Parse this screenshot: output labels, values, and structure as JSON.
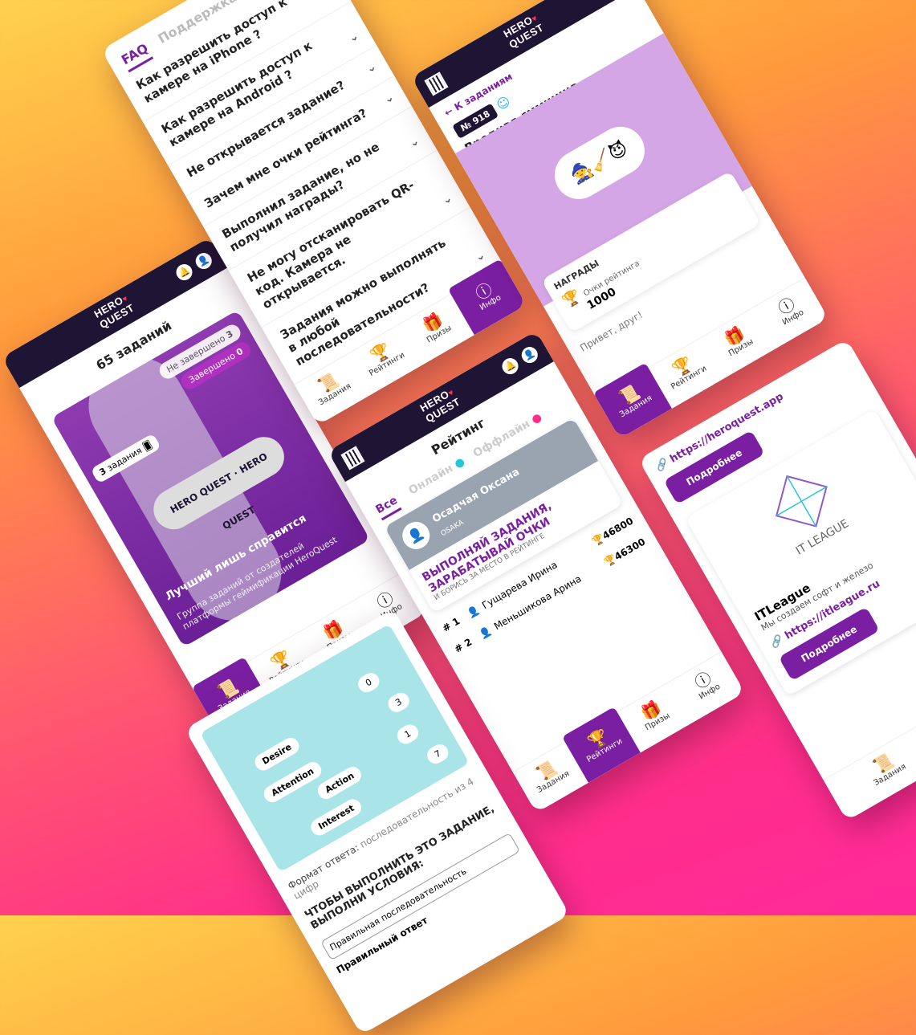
{
  "logo": {
    "line1": "HERO",
    "line2": "QUEST"
  },
  "nav": {
    "tasks": "Задания",
    "ratings": "Рейтинги",
    "prizes": "Призы",
    "info": "Инфо"
  },
  "phone1": {
    "title": "65 заданий",
    "not_done": "Не завершено",
    "not_done_count": "3",
    "done": "Завершено",
    "done_count": "0",
    "tasks_count_num": "3",
    "tasks_count_word": "задания",
    "card_title": "Лучший лишь справится",
    "card_sub": "Группа заданий от создателей платформы геймификации HeroQuest"
  },
  "phone2": {
    "tab_faq": "FAQ",
    "tab_support": "Поддержка",
    "items": [
      "Как разрешить доступ к камере на iPhone ?",
      "Как разрешить доступ к камере на Android ?",
      "Не открывается задание?",
      "Зачем мне очки рейтинга?",
      "Выполнил задание, но не получил награды?",
      "Не могу отсканировать QR-код. Камера не открывается.",
      "Задания можно выполнять в любой последовательности?"
    ]
  },
  "phone3": {
    "back": "К заданиям",
    "number": "№ 918",
    "title": "Вредная сммщица",
    "rewards_label": "НАГРАДЫ",
    "points_label": "Очки рейтинга",
    "points_value": "1000",
    "cut_text": "Привет, друг!"
  },
  "phone4": {
    "title": "Рейтинг",
    "tab_all": "Все",
    "tab_online": "Онлайн",
    "tab_offline": "Оффлайн",
    "user_name": "Осадчая Оксана",
    "user_sub": "OSAKA",
    "promo_line1": "ВЫПОЛНЯЙ ЗАДАНИЯ,",
    "promo_line2": "ЗАРАБАТЫВАЙ ОЧКИ",
    "promo_sub": "И БОРИСЬ ЗА МЕСТО В РЕЙТИНГЕ",
    "rows": [
      {
        "rank": "# 1",
        "name": "Гущарева Ирина",
        "score": "46800"
      },
      {
        "rank": "# 2",
        "name": "Меньшикова Арина",
        "score": "46300"
      }
    ]
  },
  "phone5": {
    "link1": "https://heroquest.app",
    "more": "Подробнее",
    "brand_logo": "IT LEAGUE",
    "brand_title": "ITLeague",
    "brand_desc": "Мы создаем софт и железо",
    "link2": "https://itleague.ru"
  },
  "phone6": {
    "diagram_labels": [
      "Desire",
      "Attention",
      "Action",
      "Interest"
    ],
    "diagram_nums": [
      "0",
      "3",
      "1",
      "7"
    ],
    "answer_format_label": "Формат ответа:",
    "answer_format_value": "последовательность из 4 цифр",
    "cond_title": "ЧТОБЫ ВЫПОЛНИТЬ ЭТО ЗАДАНИЕ, ВЫПОЛНИ УСЛОВИЯ:",
    "cond_1": "Правильная последовательность",
    "cond_2": "Правильный ответ"
  }
}
